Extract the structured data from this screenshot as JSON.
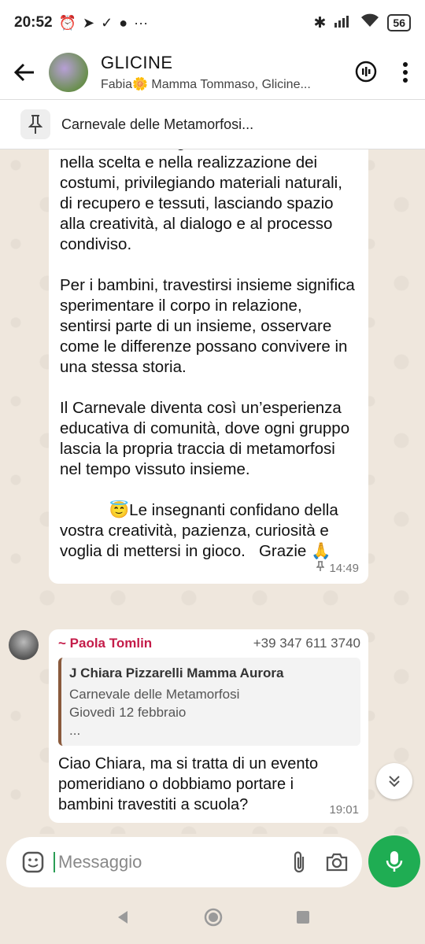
{
  "status": {
    "time": "20:52",
    "battery": "56",
    "dots": "···"
  },
  "header": {
    "title": "GLICINE",
    "subtitle": "Fabia🌼 Mamma Tommaso, Glicine..."
  },
  "pinned": {
    "text": "Carnevale delle Metamorfosi..."
  },
  "message1": {
    "paragraphs": [
      "Invitiamo le famiglie a collaborare tra loro nella scelta e nella realizzazione dei costumi, privilegiando materiali naturali, di recupero e tessuti, lasciando spazio alla creatività, al dialogo e al processo condiviso.",
      "Per i bambini, travestirsi insieme significa sperimentare il corpo in relazione, sentirsi parte di un insieme, osservare come le differenze possano convivere in una stessa storia.",
      "Il Carnevale diventa così un’esperienza educativa di comunità, dove ogni gruppo lascia la propria traccia di metamorfosi nel tempo vissuto insieme."
    ],
    "closing": "           😇Le insegnanti confidano della vostra creatività, pazienza, curiosità e voglia di mettersi in gioco.   Grazie 🙏",
    "time": "14:49"
  },
  "message2": {
    "sender": "~ Paola Tomlin",
    "phone": "+39 347 611 3740",
    "quote": {
      "name": "J Chiara Pizzarelli Mamma Aurora",
      "line1": "Carnevale delle Metamorfosi",
      "line2": "Giovedì 12 febbraio",
      "line3": "..."
    },
    "text": "Ciao Chiara, ma si tratta di un evento pomeridiano o dobbiamo portare i bambini  travestiti a scuola?",
    "time": "19:01"
  },
  "input": {
    "placeholder": "Messaggio"
  },
  "colors": {
    "accent": "#1fad53",
    "sender": "#c41c49",
    "quote_bar": "#8a5a3c",
    "chat_bg": "#efe7dd"
  },
  "icons": [
    "back-arrow-icon",
    "voice-chat-icon",
    "more-vert-icon",
    "pin-icon",
    "sticker-icon",
    "attach-icon",
    "camera-icon",
    "mic-icon",
    "chevron-double-down-icon",
    "nav-back-icon",
    "nav-home-icon",
    "nav-recents-icon"
  ]
}
